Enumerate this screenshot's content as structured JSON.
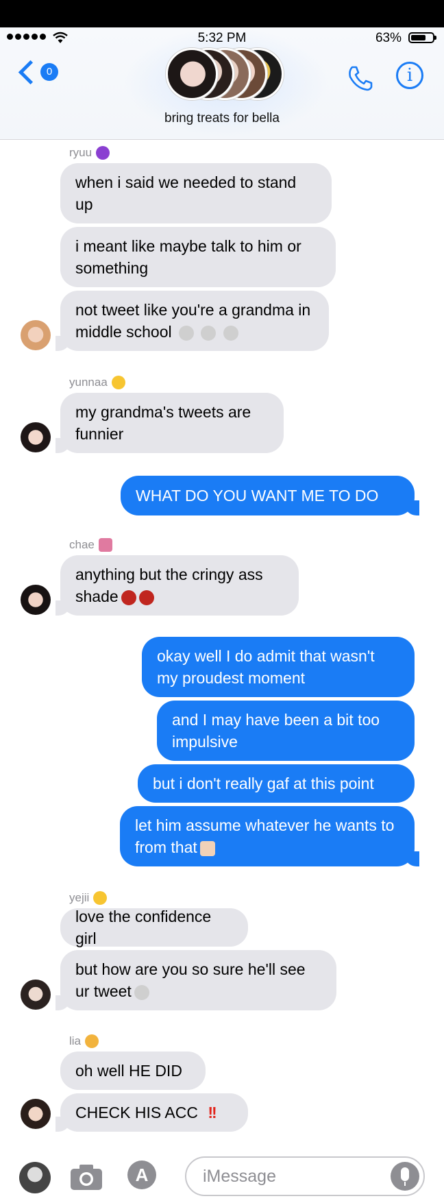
{
  "status_bar": {
    "time": "5:32 PM",
    "battery": "63%",
    "battery_level": 0.63
  },
  "header": {
    "back_badge": "0",
    "group_name": "bring treats for bella"
  },
  "messages": [
    {
      "sender": "ryuu",
      "emoji_color": "#8a3fd1"
    },
    {
      "text": "when i said we needed to stand up"
    },
    {
      "text": "i meant like maybe talk to him or something"
    },
    {
      "text": "not tweet like you're a grandma in middle school"
    },
    {
      "sender": "yunnaa",
      "emoji_color": "#f7c531"
    },
    {
      "text": "my grandma's tweets are funnier"
    },
    {
      "text": "WHAT DO YOU WANT ME TO DO"
    },
    {
      "sender": "chae",
      "emoji_color": "#e07aa0"
    },
    {
      "text": "anything but the cringy ass shade"
    },
    {
      "text": "okay well I do admit that wasn't my proudest moment"
    },
    {
      "text": "and I may have been a bit too impulsive"
    },
    {
      "text": "but i don't really gaf at this point"
    },
    {
      "text": "let him assume whatever he wants to from that"
    },
    {
      "sender": "yejii",
      "emoji_color": "#f7c531"
    },
    {
      "text": "love the confidence girl"
    },
    {
      "text": "but how are you so sure he'll see ur tweet"
    },
    {
      "sender": "lia",
      "emoji_color": "#f2b33d"
    },
    {
      "text": "oh well HE DID"
    },
    {
      "text": "CHECK HIS ACC"
    }
  ],
  "composer": {
    "placeholder": "iMessage"
  },
  "colors": {
    "blue": "#1a7cf5",
    "incoming": "#e5e5ea",
    "red": "#e2231a"
  }
}
